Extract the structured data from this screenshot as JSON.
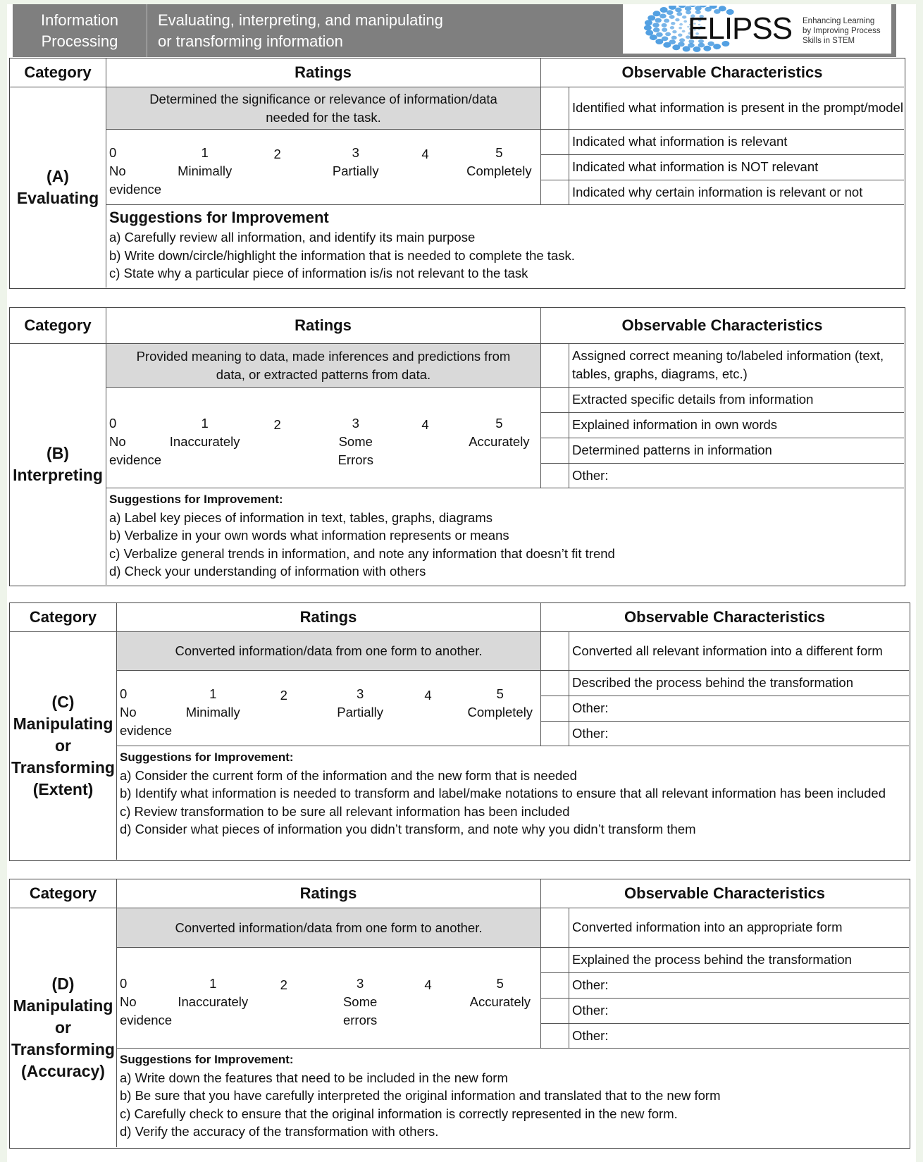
{
  "header": {
    "section_title": [
      "Information",
      "Processing"
    ],
    "description": [
      "Evaluating, interpreting, and manipulating",
      "or transforming information"
    ],
    "logo": {
      "name": "ELIPSS",
      "tagline": [
        "Enhancing Learning",
        "by Improving Process",
        "Skills in STEM"
      ],
      "accent_color": "#4a9be0"
    },
    "bar_color": "#7f7f7f"
  },
  "column_headers": {
    "category": "Category",
    "ratings": "Ratings",
    "observable": "Observable Characteristics"
  },
  "scale_numbers": [
    "0",
    "1",
    "2",
    "3",
    "4",
    "5"
  ],
  "sections": [
    {
      "id": "A",
      "category": [
        "(A)",
        "Evaluating"
      ],
      "description": [
        "Determined the significance or relevance of information/data",
        "needed for the task."
      ],
      "scale_labels": {
        "0": [
          "No",
          "evidence"
        ],
        "1": [
          "Minimally"
        ],
        "3": [
          "Partially"
        ],
        "5": [
          "Completely"
        ]
      },
      "observables": [
        "Identified what information is present in the prompt/model",
        "Indicated what information is relevant",
        "Indicated what information is NOT relevant",
        "Indicated why certain information is relevant or not"
      ],
      "suggestions_title": "Suggestions for Improvement",
      "suggestions": [
        "a) Carefully review all information, and identify its main purpose",
        "b) Write down/circle/highlight the information that is needed to complete the task.",
        "c) State why a particular piece of information is/is not relevant to the task"
      ]
    },
    {
      "id": "B",
      "category": [
        "(B)",
        "Interpreting"
      ],
      "description": [
        "Provided meaning to data, made inferences and predictions from",
        "data, or extracted patterns from data."
      ],
      "scale_labels": {
        "0": [
          "No",
          "evidence"
        ],
        "1": [
          "Inaccurately"
        ],
        "3": [
          "Some",
          "Errors"
        ],
        "5": [
          "Accurately"
        ]
      },
      "observables": [
        "Assigned correct meaning to/labeled information (text, tables, graphs, diagrams, etc.)",
        "Extracted specific details from information",
        "Explained information in own words",
        "Determined patterns in information",
        "Other:"
      ],
      "suggestions_title": "Suggestions for Improvement:",
      "suggestions": [
        "a) Label key pieces of information in text, tables, graphs, diagrams",
        "b) Verbalize in your own words what information represents or means",
        "c) Verbalize general trends in information, and note any information that doesn’t fit trend",
        "d) Check your understanding of information with others"
      ]
    },
    {
      "id": "C",
      "category": [
        "(C)",
        "Manipulating",
        "or",
        "Transforming",
        "(Extent)"
      ],
      "description": [
        "Converted information/data from one form to another."
      ],
      "scale_labels": {
        "0": [
          "No",
          "evidence"
        ],
        "1": [
          "Minimally"
        ],
        "3": [
          "Partially"
        ],
        "5": [
          "Completely"
        ]
      },
      "observables": [
        "Converted all relevant information into a different form",
        "Described the process behind the transformation",
        "Other:",
        "Other:"
      ],
      "suggestions_title": "Suggestions for Improvement:",
      "suggestions": [
        "a) Consider the current form of the information and the new form that is needed",
        "b) Identify what information is needed to transform and label/make notations to ensure that all relevant information has been included",
        "c) Review transformation to be sure all relevant information has been included",
        "d) Consider what pieces of information you didn’t transform, and note why you didn’t transform them"
      ]
    },
    {
      "id": "D",
      "category": [
        "(D)",
        "Manipulating",
        "or",
        "Transforming",
        "(Accuracy)"
      ],
      "description": [
        "Converted information/data from one form to another."
      ],
      "scale_labels": {
        "0": [
          "No",
          "evidence"
        ],
        "1": [
          "Inaccurately"
        ],
        "3": [
          "Some",
          "errors"
        ],
        "5": [
          "Accurately"
        ]
      },
      "observables": [
        "Converted information into an appropriate form",
        "Explained the process behind the transformation",
        "Other:",
        "Other:",
        "Other:"
      ],
      "suggestions_title": "Suggestions for Improvement:",
      "suggestions": [
        "a) Write down the features that need to be included in the new form",
        "b) Be sure that you have carefully interpreted the original information and translated that to the new form",
        "c) Carefully check to ensure that the original information is correctly represented in the new form.",
        "d) Verify the accuracy of the transformation with others."
      ]
    }
  ]
}
